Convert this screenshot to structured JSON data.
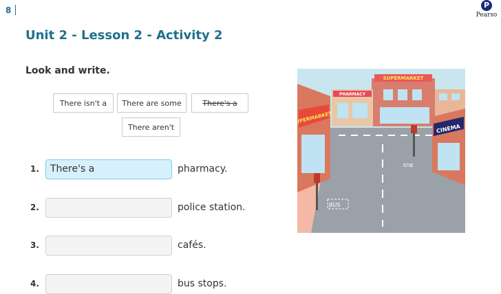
{
  "page": {
    "number": "8"
  },
  "brand": {
    "mark": "P",
    "name": "Pearso"
  },
  "lesson": {
    "title": "Unit 2 - Lesson 2 - Activity 2",
    "instruction": "Look and write."
  },
  "word_bank": [
    {
      "text": "There isn't a",
      "used": false
    },
    {
      "text": "There are some",
      "used": false
    },
    {
      "text": "There's a",
      "used": true
    },
    {
      "text": "There aren't",
      "used": false
    }
  ],
  "questions": [
    {
      "number": "1.",
      "answer": "There's a",
      "suffix": "pharmacy."
    },
    {
      "number": "2.",
      "answer": "",
      "suffix": "police station."
    },
    {
      "number": "3.",
      "answer": "",
      "suffix": "cafés."
    },
    {
      "number": "4.",
      "answer": "",
      "suffix": "bus stops."
    }
  ],
  "scene": {
    "signs": {
      "supermarket_top": "SUPERMARKET",
      "pharmacy": "PHARMACY",
      "supermarket_side": "SUPERMARKET",
      "cinema": "CINEMA",
      "bus_left": "BUS",
      "bus_right": "BUS"
    }
  }
}
